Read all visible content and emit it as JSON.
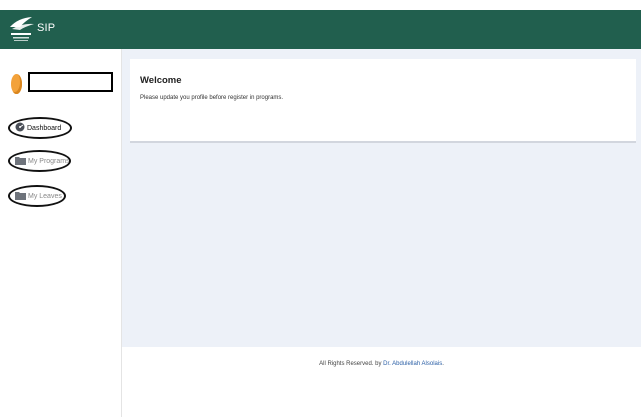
{
  "header": {
    "brand": "SIP"
  },
  "sidebar": {
    "items": [
      {
        "label": "Dashboard"
      },
      {
        "label": "My Programs"
      },
      {
        "label": "My Leaves"
      }
    ]
  },
  "main": {
    "welcome_title": "Welcome",
    "welcome_message": "Please update you profile before register in programs."
  },
  "footer": {
    "prefix": "All Rights Reserved. by ",
    "author": "Dr. Abdulellah Alsolais",
    "suffix": "."
  },
  "colors": {
    "header_bg": "#215f4e",
    "content_bg": "#edf1f8",
    "link": "#2b5fa6",
    "avatar": "#f3a23a"
  }
}
